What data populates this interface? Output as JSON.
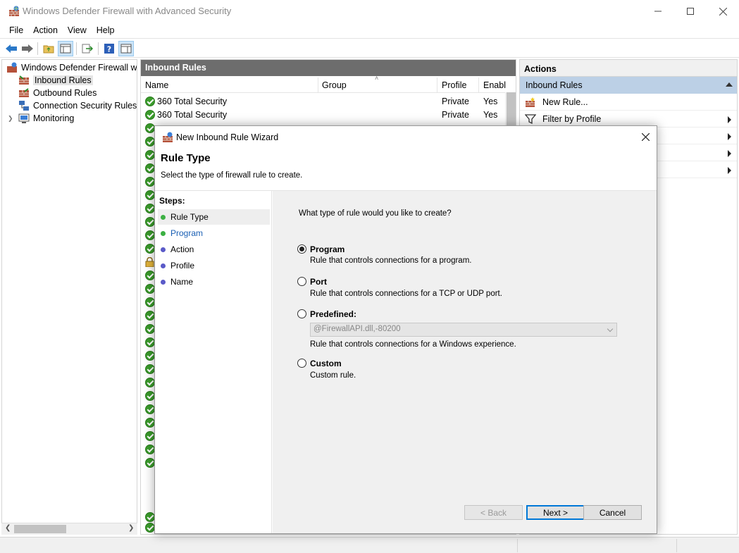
{
  "window": {
    "title": "Windows Defender Firewall with Advanced Security"
  },
  "menu": [
    "File",
    "Action",
    "View",
    "Help"
  ],
  "tree": {
    "root": "Windows Defender Firewall witl",
    "items": [
      "Inbound Rules",
      "Outbound Rules",
      "Connection Security Rules",
      "Monitoring"
    ]
  },
  "center": {
    "header": "Inbound Rules",
    "columns": {
      "name": "Name",
      "group": "Group",
      "profile": "Profile",
      "enabled": "Enabl"
    },
    "rows": [
      {
        "name": "360 Total Security",
        "profile": "Private",
        "enabled": "Yes"
      },
      {
        "name": "360 Total Security",
        "profile": "Private",
        "enabled": "Yes"
      }
    ]
  },
  "actions": {
    "title": "Actions",
    "section": "Inbound Rules",
    "items": [
      "New Rule...",
      "Filter by Profile"
    ]
  },
  "dialog": {
    "title": "New Inbound Rule Wizard",
    "heading": "Rule Type",
    "subheading": "Select the type of firewall rule to create.",
    "steps_header": "Steps:",
    "steps": [
      "Rule Type",
      "Program",
      "Action",
      "Profile",
      "Name"
    ],
    "question": "What type of rule would you like to create?",
    "options": [
      {
        "title": "Program",
        "desc": "Rule that controls connections for a program."
      },
      {
        "title": "Port",
        "desc": "Rule that controls connections for a TCP or UDP port."
      },
      {
        "title": "Predefined:",
        "desc": "Rule that controls connections for a Windows experience."
      },
      {
        "title": "Custom",
        "desc": "Custom rule."
      }
    ],
    "selected_option": "Program",
    "predefined_value": "@FirewallAPI.dll,-80200",
    "buttons": {
      "back": "< Back",
      "next": "Next >",
      "cancel": "Cancel"
    }
  },
  "colors": {
    "accent": "#0078d7",
    "panel_header": "#6d6d6d",
    "actions_highlight": "#bcd0e6",
    "step_done": "#3cb043",
    "step_todo": "#5a5ac8"
  }
}
